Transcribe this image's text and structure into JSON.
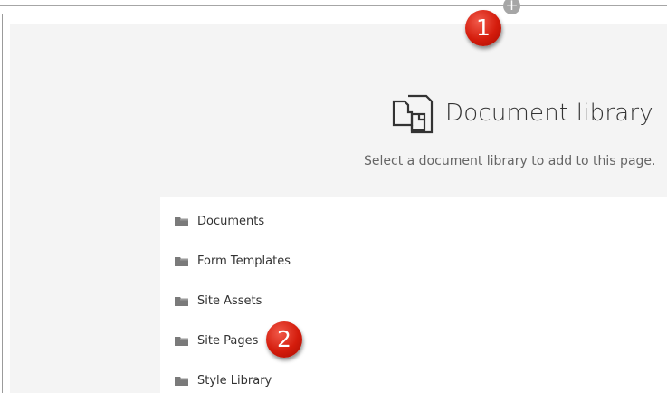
{
  "add_section": {
    "symbol": "+"
  },
  "header": {
    "title": "Document library",
    "subtitle": "Select a document library to add to this page."
  },
  "libraries": [
    {
      "label": "Documents"
    },
    {
      "label": "Form Templates"
    },
    {
      "label": "Site Assets"
    },
    {
      "label": "Site Pages"
    },
    {
      "label": "Style Library"
    }
  ],
  "callouts": [
    {
      "number": "1"
    },
    {
      "number": "2"
    }
  ],
  "colors": {
    "callout": "#d41c0c",
    "placeholder_bg": "#f4f4f4",
    "folder": "#7a7a7a"
  }
}
